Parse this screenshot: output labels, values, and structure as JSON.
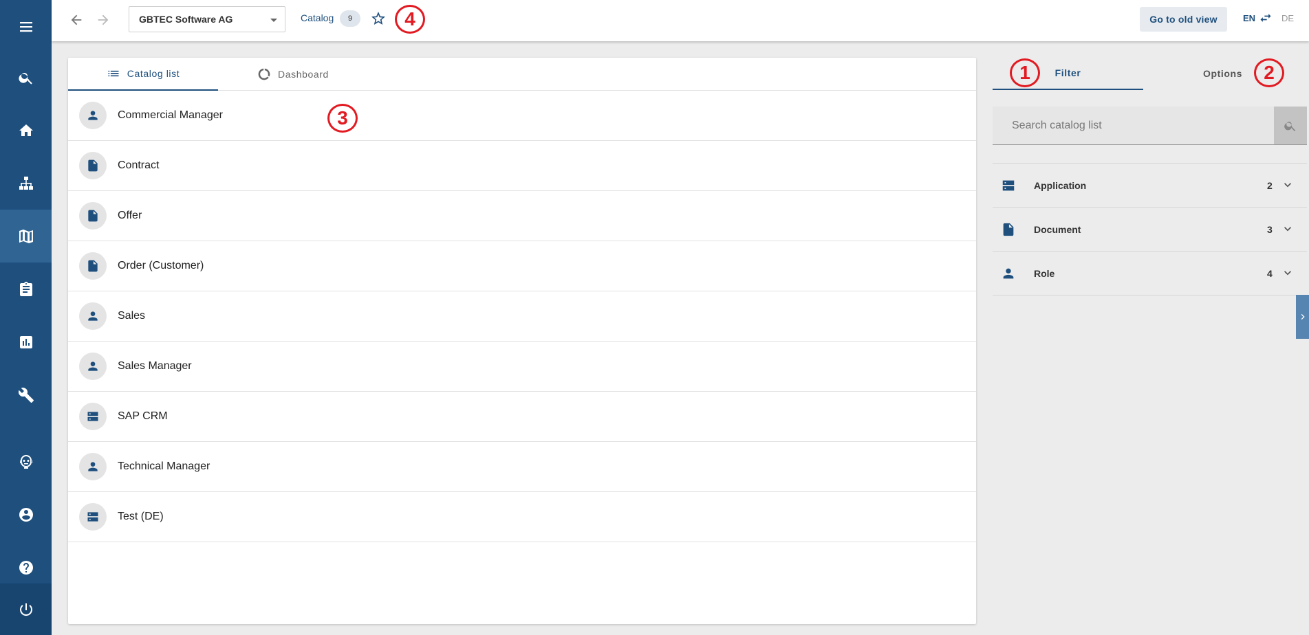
{
  "sidebar": {
    "items": [
      {
        "icon": "menu-icon"
      },
      {
        "icon": "search-icon"
      },
      {
        "icon": "home-icon"
      },
      {
        "icon": "sitemap-icon"
      },
      {
        "icon": "catalog-map-icon",
        "active": true
      },
      {
        "icon": "clipboard-icon"
      },
      {
        "icon": "chart-icon"
      },
      {
        "icon": "wrench-icon"
      },
      {
        "icon": "robot-icon"
      },
      {
        "icon": "account-icon"
      },
      {
        "icon": "help-icon"
      },
      {
        "icon": "power-icon"
      }
    ]
  },
  "topbar": {
    "company": "GBTEC Software AG",
    "breadcrumb": "Catalog",
    "count": "9",
    "old_view_label": "Go to old view",
    "lang_active": "EN",
    "lang_other": "DE"
  },
  "annotations": [
    "1",
    "2",
    "3",
    "4"
  ],
  "main": {
    "tabs": [
      {
        "label": "Catalog list",
        "icon": "list-icon",
        "active": true
      },
      {
        "label": "Dashboard",
        "icon": "donut-icon",
        "active": false
      }
    ],
    "items": [
      {
        "label": "Commercial Manager",
        "type": "role"
      },
      {
        "label": "Contract",
        "type": "document"
      },
      {
        "label": "Offer",
        "type": "document"
      },
      {
        "label": "Order (Customer)",
        "type": "document"
      },
      {
        "label": "Sales",
        "type": "role"
      },
      {
        "label": "Sales Manager",
        "type": "role"
      },
      {
        "label": "SAP CRM",
        "type": "application"
      },
      {
        "label": "Technical Manager",
        "type": "role"
      },
      {
        "label": "Test (DE)",
        "type": "application"
      }
    ]
  },
  "panel": {
    "tabs": [
      {
        "label": "Filter",
        "active": true
      },
      {
        "label": "Options",
        "active": false
      }
    ],
    "search_placeholder": "Search catalog list",
    "facets": [
      {
        "label": "Application",
        "count": "2",
        "type": "application"
      },
      {
        "label": "Document",
        "count": "3",
        "type": "document"
      },
      {
        "label": "Role",
        "count": "4",
        "type": "role"
      }
    ]
  },
  "colors": {
    "brand": "#1e4f7d",
    "sidebar": "#1e4f7d",
    "annotation": "#e21b22"
  }
}
